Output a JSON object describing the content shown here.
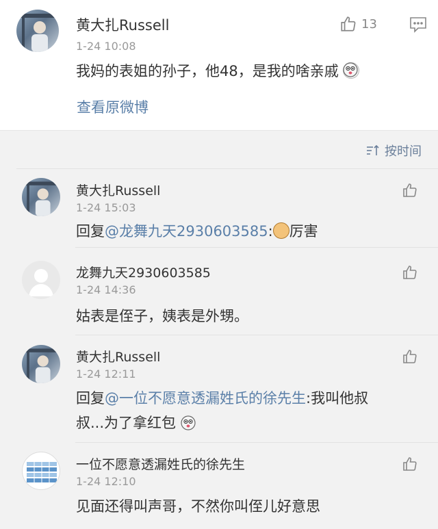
{
  "post": {
    "author": "黄大扎Russell",
    "time": "1-24 10:08",
    "text": "我妈的表姐的孙子，他48，是我的啥亲戚",
    "like_count": "13",
    "view_original": "查看原微博"
  },
  "sort_label": "按时间",
  "comments": [
    {
      "author": "黄大扎Russell",
      "time": "1-24 15:03",
      "reply_prefix": "回复",
      "mention": "@龙舞九天2930603585",
      "colon": ":",
      "text": "厉害"
    },
    {
      "author": "龙舞九天2930603585",
      "time": "1-24 14:36",
      "text": "姑表是侄子，姨表是外甥。"
    },
    {
      "author": "黄大扎Russell",
      "time": "1-24 12:11",
      "reply_prefix": "回复",
      "mention": "@一位不愿意透漏姓氏的徐先生",
      "colon": ":",
      "text_line1": "我叫他叔",
      "text_line2": "叔...为了拿红包"
    },
    {
      "author": "一位不愿意透漏姓氏的徐先生",
      "time": "1-24 12:10",
      "text": "见面还得叫声哥，不然你叫侄儿好意思"
    }
  ],
  "colors": {
    "link": "#5a7fa8",
    "meta": "#999999",
    "background": "#f2f2f2"
  },
  "icons": [
    "thumbs-up-icon",
    "comment-icon",
    "sort-icon",
    "emoji-icon"
  ]
}
